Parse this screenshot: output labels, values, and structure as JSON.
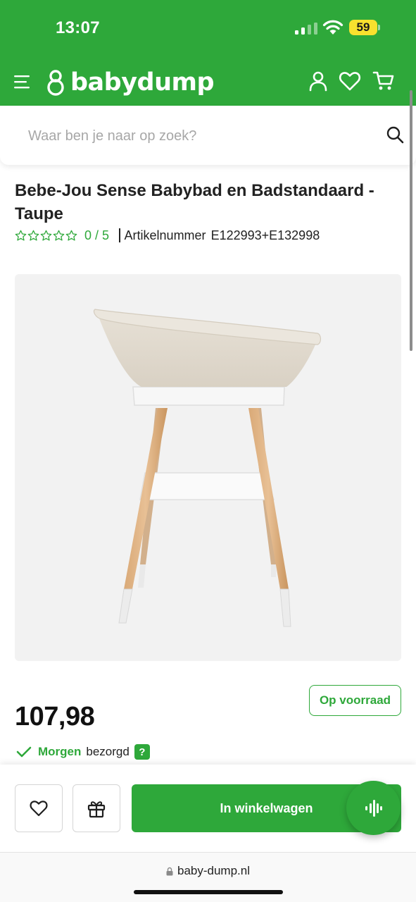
{
  "status_bar": {
    "time": "13:07",
    "battery": "59"
  },
  "header": {
    "brand": "babydump"
  },
  "search": {
    "placeholder": "Waar ben je naar op zoek?"
  },
  "product": {
    "title": "Bebe-Jou Sense Babybad en Badstandaard - Taupe",
    "rating": "0 / 5",
    "stars_filled": 0,
    "stars_total": 5,
    "article_label": "Artikelnummer",
    "article_number": "E122993+E132998",
    "price": "107,98",
    "stock": "Op voorraad",
    "delivery_strong": "Morgen",
    "delivery_rest": "bezorgd",
    "help": "?"
  },
  "actions": {
    "add_to_cart": "In winkelwagen"
  },
  "browser": {
    "url": "baby-dump.nl"
  },
  "colors": {
    "brand_green": "#2ea83a",
    "battery_yellow": "#f8e12e"
  },
  "icons": [
    "menu-icon",
    "logo-icon",
    "account-icon",
    "wishlist-icon",
    "cart-icon",
    "search-icon",
    "star-icon",
    "check-icon",
    "heart-icon",
    "gift-icon",
    "voice-icon",
    "lock-icon"
  ]
}
